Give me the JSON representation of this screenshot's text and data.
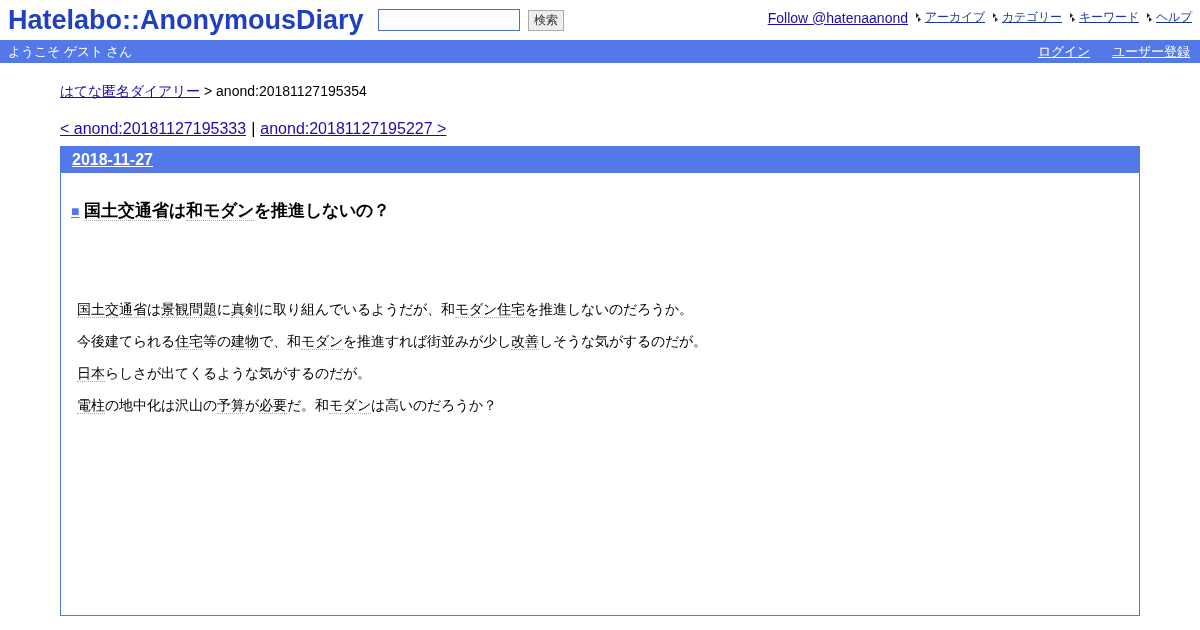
{
  "header": {
    "logo": "Hatelabo::AnonymousDiary",
    "search": {
      "button": "検索"
    },
    "follow": "Follow @hatenaanond",
    "nav": [
      "アーカイブ",
      "カテゴリー",
      "キーワード",
      "ヘルプ"
    ]
  },
  "welcome_bar": {
    "greeting": "ようこそ ゲスト さん",
    "links": [
      "ログイン",
      "ユーザー登録"
    ]
  },
  "breadcrumb": {
    "home": "はてな匿名ダイアリー",
    "current": "> anond:20181127195354"
  },
  "pager": {
    "prev": "< anond:20181127195333",
    "separator": "|",
    "next": "anond:20181127195227 >"
  },
  "entry": {
    "date": "2018-11-27",
    "mark": "■",
    "title": [
      {
        "text": "国土交通省",
        "keyword": true
      },
      {
        "text": "は",
        "keyword": false
      },
      {
        "text": "和モダン",
        "keyword": true
      },
      {
        "text": "を推進しないの？",
        "keyword": false
      }
    ],
    "paragraphs": [
      [
        {
          "text": "国土交通省",
          "keyword": true
        },
        {
          "text": "は",
          "keyword": false
        },
        {
          "text": "景観問題",
          "keyword": true
        },
        {
          "text": "に",
          "keyword": false
        },
        {
          "text": "真剣",
          "keyword": true
        },
        {
          "text": "に取り組んでいるようだが、和",
          "keyword": false
        },
        {
          "text": "モダン住宅",
          "keyword": true
        },
        {
          "text": "を推進しないのだろうか。",
          "keyword": false
        }
      ],
      [
        {
          "text": "今後建てられる",
          "keyword": false
        },
        {
          "text": "住宅",
          "keyword": true
        },
        {
          "text": "等の",
          "keyword": false
        },
        {
          "text": "建物",
          "keyword": true
        },
        {
          "text": "で、和",
          "keyword": false
        },
        {
          "text": "モダン",
          "keyword": true
        },
        {
          "text": "を推進すれば街並みが少し",
          "keyword": false
        },
        {
          "text": "改善",
          "keyword": true
        },
        {
          "text": "しそうな気がするのだが。",
          "keyword": false
        }
      ],
      [
        {
          "text": "日本",
          "keyword": true
        },
        {
          "text": "らしさが出てくるような気がするのだが。",
          "keyword": false
        }
      ],
      [
        {
          "text": "電柱",
          "keyword": true
        },
        {
          "text": "の地中化は沢山の",
          "keyword": false
        },
        {
          "text": "予算",
          "keyword": true
        },
        {
          "text": "が",
          "keyword": false
        },
        {
          "text": "必要",
          "keyword": true
        },
        {
          "text": "だ。和",
          "keyword": false
        },
        {
          "text": "モダン",
          "keyword": true
        },
        {
          "text": "は高いのだろうか？",
          "keyword": false
        }
      ]
    ]
  }
}
